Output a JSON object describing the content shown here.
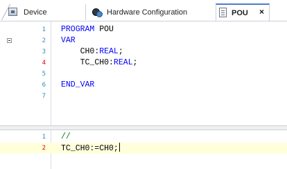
{
  "tabs": [
    {
      "label": "Device",
      "icon": "device-icon"
    },
    {
      "label": "Hardware Configuration",
      "icon": "hardware-config-icon"
    },
    {
      "label": "POU",
      "icon": "pou-icon",
      "active": true
    }
  ],
  "close_glyph": "×",
  "declaration": {
    "lines": [
      {
        "num": "1",
        "keyword": "PROGRAM",
        "rest": " POU"
      },
      {
        "num": "2",
        "keyword": "VAR",
        "rest": ""
      },
      {
        "num": "3",
        "indent": "    ",
        "name": "CH0:",
        "type": "REAL",
        "end": ";"
      },
      {
        "num": "4",
        "indent": "    ",
        "name": "TC_CH0:",
        "type": "REAL",
        "end": ";"
      },
      {
        "num": "5"
      },
      {
        "num": "6",
        "keyword": "END_VAR",
        "rest": ""
      },
      {
        "num": "7"
      }
    ]
  },
  "implementation": {
    "lines": [
      {
        "num": "1",
        "comment": "//"
      },
      {
        "num": "2",
        "code": "TC_CH0:=CH0;"
      }
    ]
  },
  "colors": {
    "keyword": "#0000ff",
    "comment": "#008000",
    "line_number": "#2b91af",
    "modified_line_number": "#d60000",
    "active_line_bg": "#ffffdc"
  }
}
